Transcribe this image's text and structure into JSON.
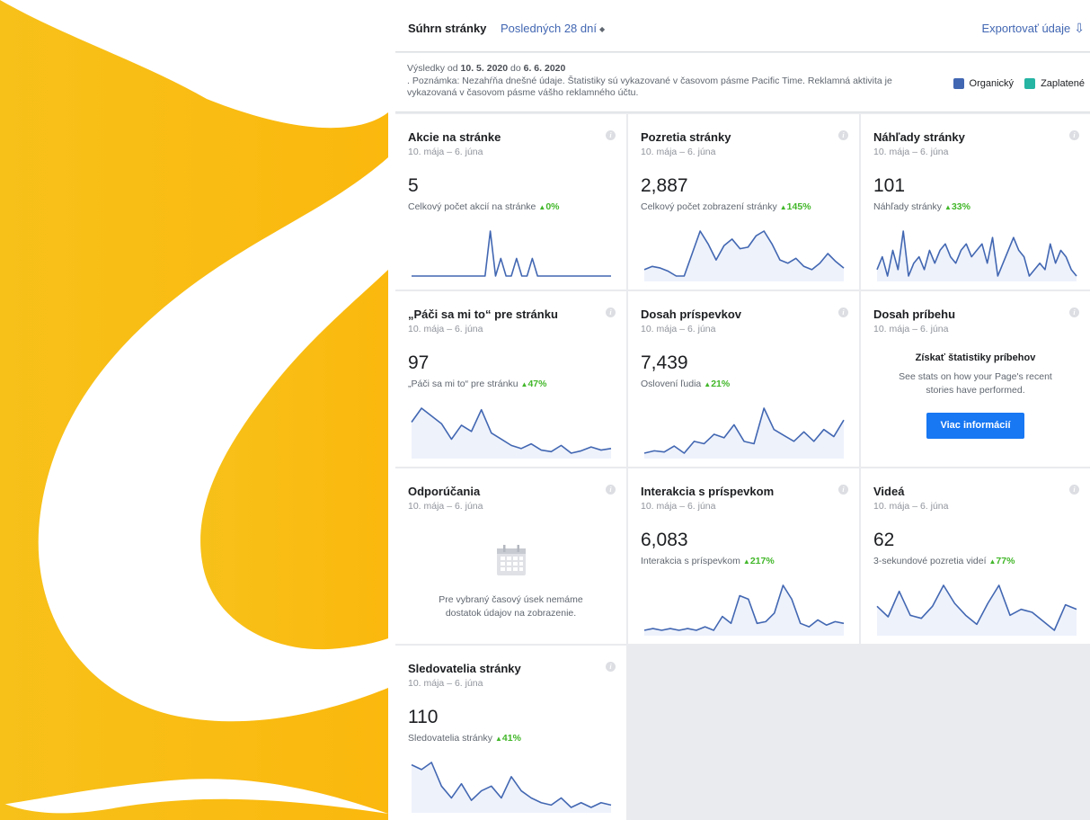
{
  "header": {
    "title": "Súhrn stránky",
    "period": "Posledných 28 dní",
    "export": "Exportovať údaje"
  },
  "notice": {
    "range_prefix": "Výsledky od",
    "range_from": "10. 5. 2020",
    "range_mid": "do",
    "range_to": "6. 6. 2020",
    "note": ". Poznámka: Nezahŕňa dnešné údaje. Štatistiky sú vykazované v časovom pásme Pacific Time. Reklamná aktivita je vykazovaná v časovom pásme vášho reklamného účtu."
  },
  "legend": {
    "organic": "Organický",
    "paid": "Zaplatené",
    "organic_color": "#4267b2",
    "paid_color": "#26b4a3"
  },
  "colors": {
    "line": "#4267b2",
    "fill": "#eef2fb",
    "positive": "#42b72a",
    "brand": "#fcb813"
  },
  "cards": {
    "actions": {
      "title": "Akcie na stránke",
      "date": "10. mája – 6. júna",
      "value": "5",
      "sub": "Celkový počet akcií na stránke",
      "change": "0%",
      "series": [
        0,
        0,
        0,
        0,
        0,
        0,
        0,
        0,
        0,
        0,
        0,
        0,
        0,
        0,
        0,
        2.3,
        0,
        0.9,
        0,
        0,
        0.9,
        0,
        0,
        0.9,
        0,
        0,
        0,
        0,
        0,
        0,
        0,
        0,
        0,
        0,
        0,
        0,
        0,
        0,
        0
      ]
    },
    "views": {
      "title": "Pozretia stránky",
      "date": "10. mája – 6. júna",
      "value": "2,887",
      "sub": "Celkový počet zobrazení stránky",
      "change": "145%",
      "series": [
        40,
        42,
        41,
        39,
        36,
        36,
        50,
        64,
        56,
        46,
        55,
        59,
        53,
        54,
        61,
        64,
        56,
        46,
        44,
        47,
        42,
        40,
        44,
        50,
        45,
        41
      ]
    },
    "previews": {
      "title": "Náhľady stránky",
      "date": "10. mája – 6. júna",
      "value": "101",
      "sub": "Náhľady stránky",
      "change": "33%",
      "series": [
        2,
        4,
        1,
        5,
        2,
        8,
        1,
        3,
        4,
        2,
        5,
        3,
        5,
        6,
        4,
        3,
        5,
        6,
        4,
        5,
        6,
        3,
        7,
        1,
        3,
        5,
        7,
        5,
        4,
        1,
        2,
        3,
        2,
        6,
        3,
        5,
        4,
        2,
        1
      ]
    },
    "likes": {
      "title": "„Páči sa mi to“ pre stránku",
      "date": "10. mája – 6. júna",
      "value": "97",
      "sub": "„Páči sa mi to“ pre stránku",
      "change": "47%",
      "series": [
        62,
        80,
        70,
        60,
        40,
        58,
        50,
        78,
        48,
        40,
        32,
        28,
        34,
        26,
        24,
        32,
        22,
        25,
        30,
        26,
        28
      ]
    },
    "reach": {
      "title": "Dosah príspevkov",
      "date": "10. mája – 6. júna",
      "value": "7,439",
      "sub": "Oslovení ľudia",
      "change": "21%",
      "series": [
        20,
        22,
        21,
        26,
        20,
        30,
        28,
        36,
        33,
        44,
        30,
        28,
        58,
        40,
        35,
        30,
        38,
        30,
        40,
        34,
        48
      ]
    },
    "stories": {
      "title": "Dosah príbehu",
      "date": "10. mája – 6. júna",
      "promo_title": "Získať štatistiky príbehov",
      "promo_desc": "See stats on how your Page's recent stories have performed.",
      "button": "Viac informácií"
    },
    "recommendations": {
      "title": "Odporúčania",
      "date": "10. mája – 6. júna",
      "empty": "Pre vybraný časový úsek nemáme dostatok údajov na zobrazenie."
    },
    "engagement": {
      "title": "Interakcia s príspevkom",
      "date": "10. mája – 6. júna",
      "value": "6,083",
      "sub": "Interakcia s príspevkom",
      "change": "217%",
      "series": [
        10,
        11,
        10,
        11,
        10,
        11,
        10,
        12,
        10,
        18,
        14,
        30,
        28,
        14,
        15,
        20,
        36,
        28,
        14,
        12,
        16,
        13,
        15,
        14
      ]
    },
    "videos": {
      "title": "Videá",
      "date": "10. mája – 6. júna",
      "value": "62",
      "sub": "3-sekundové pozretia videí",
      "change": "77%",
      "series": [
        32,
        25,
        42,
        26,
        24,
        32,
        46,
        34,
        26,
        20,
        34,
        46,
        26,
        30,
        28,
        22,
        16,
        33,
        30
      ]
    },
    "followers": {
      "title": "Sledovatelia stránky",
      "date": "10. mája – 6. júna",
      "value": "110",
      "sub": "Sledovatelia stránky",
      "change": "41%",
      "series": [
        58,
        54,
        60,
        40,
        30,
        42,
        28,
        36,
        40,
        30,
        48,
        36,
        30,
        26,
        24,
        30,
        22,
        26,
        22,
        26,
        24
      ]
    }
  }
}
